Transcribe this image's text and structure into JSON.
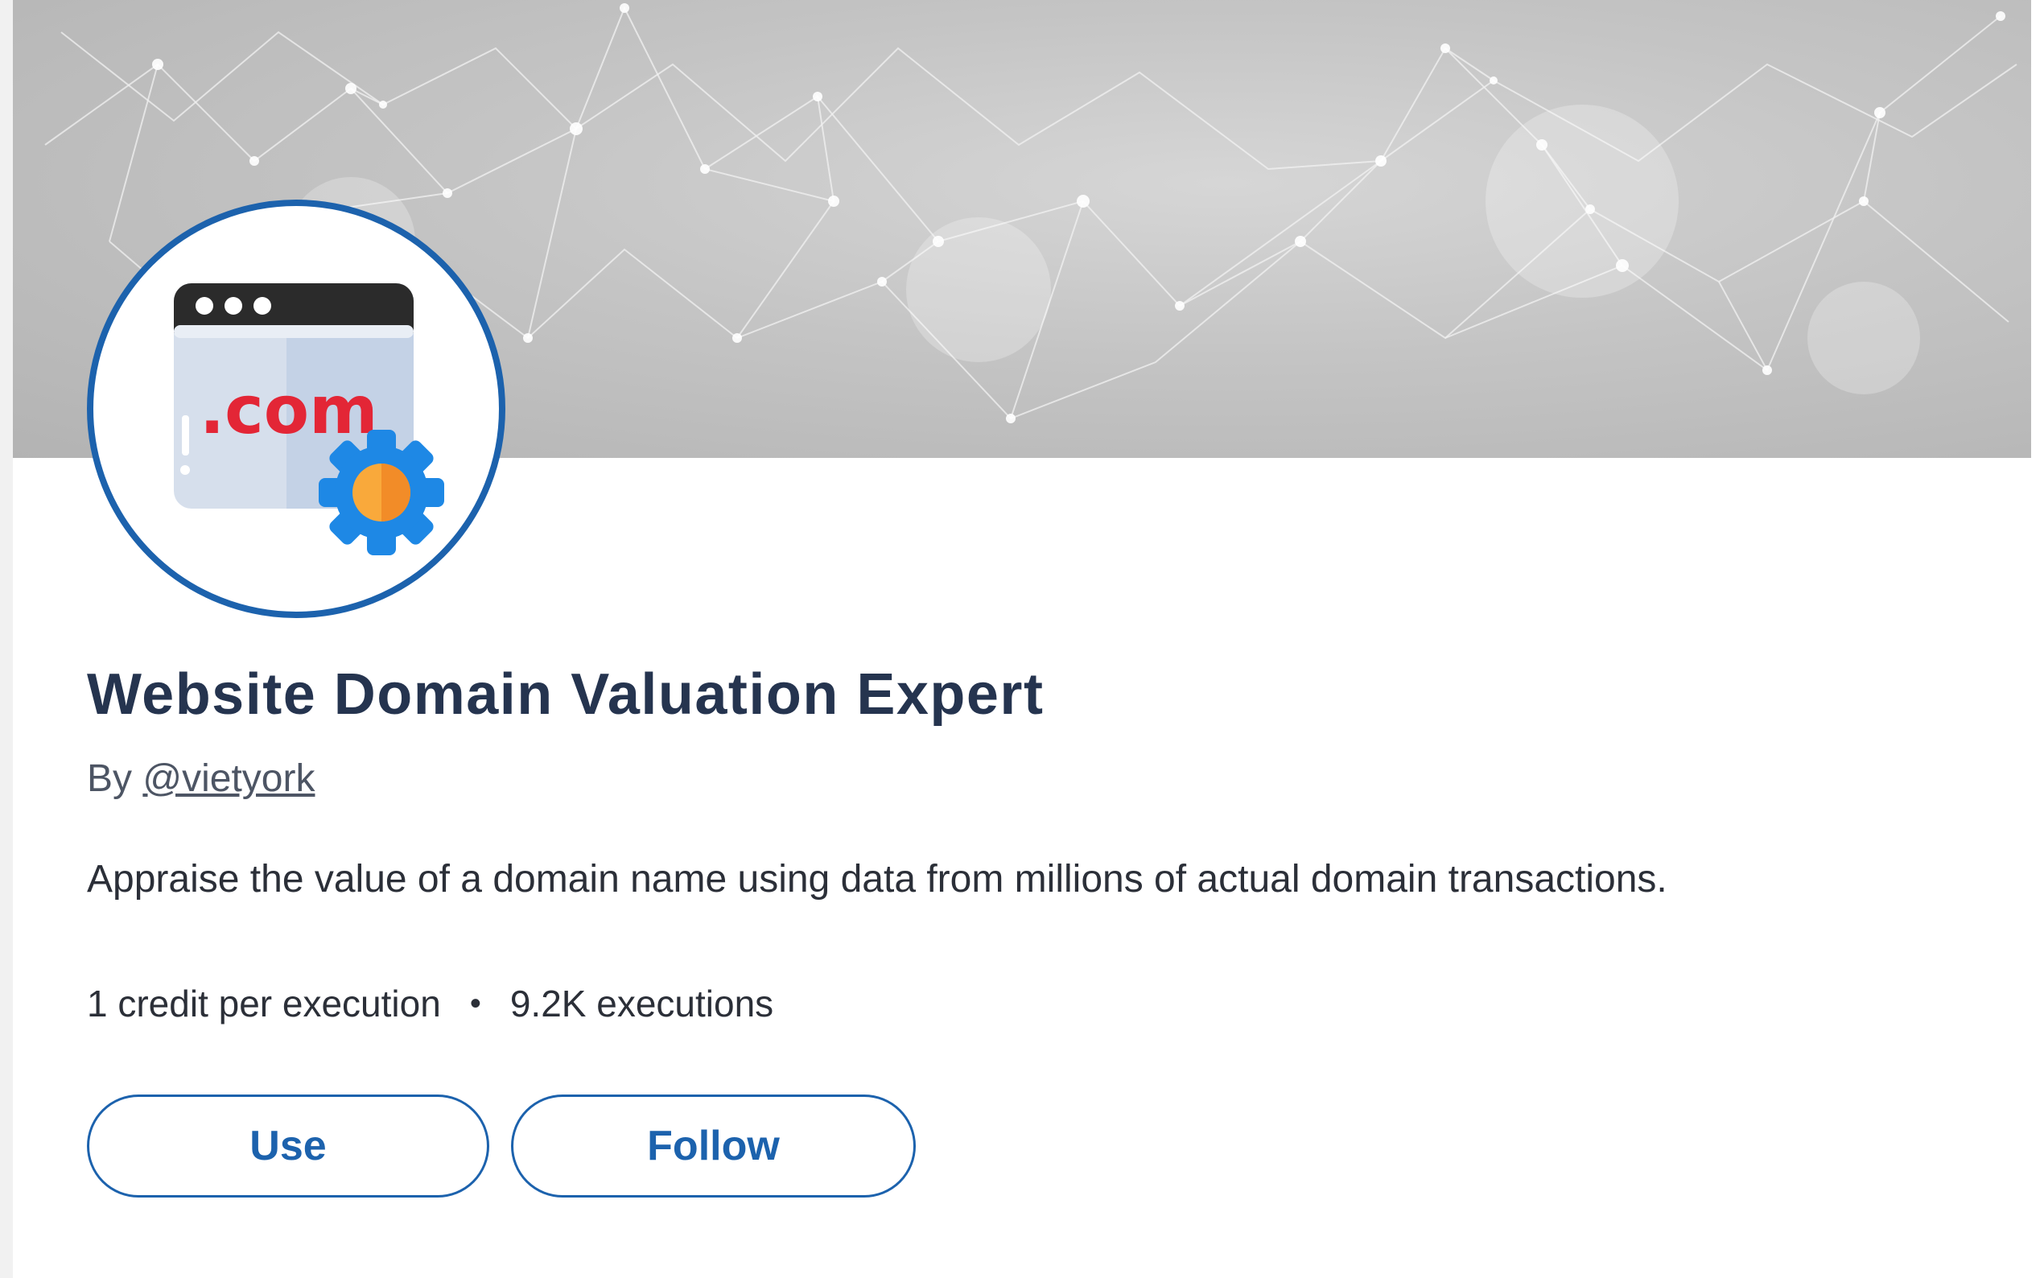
{
  "agent": {
    "title": "Website Domain Valuation Expert",
    "by_prefix": "By",
    "author": "@vietyork",
    "description": "Appraise the value of a domain name using data from millions of actual domain transactions.",
    "credits": "1 credit per execution",
    "separator": "•",
    "executions": "9.2K executions",
    "avatar_text": ".com",
    "avatar_icon": "domain-gear-icon"
  },
  "actions": {
    "use_label": "Use",
    "follow_label": "Follow"
  },
  "colors": {
    "accent": "#1c62ad",
    "title": "#25344f",
    "domain_red": "#e32636",
    "gear_blue": "#1e88e5",
    "gear_center": "#f9a93b"
  }
}
